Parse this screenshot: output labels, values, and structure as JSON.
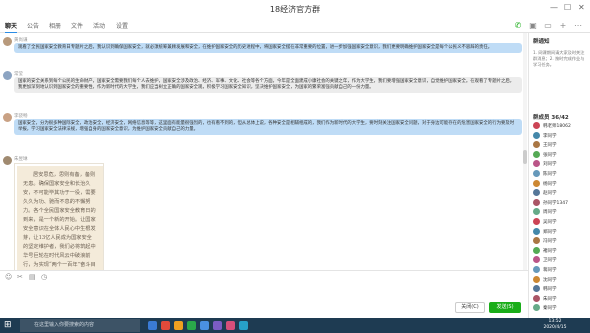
{
  "window": {
    "title": "18经济官方群"
  },
  "tabs": [
    {
      "label": "聊天"
    },
    {
      "label": "公告"
    },
    {
      "label": "相册"
    },
    {
      "label": "文件"
    },
    {
      "label": "活动"
    },
    {
      "label": "设置"
    }
  ],
  "messages": [
    {
      "sender": "黄尚谦",
      "text": "观看了全民国家安全教育日专题片之后，我认识到确保国家安全，就必须统筹兼顾发展和安全，在维护国家安全的历史进程中，将国家安全摆在非常重要的位置，进一步加强国家安全意识，我们更要明确维护国家安全是每个公民义不容辞的责任。"
    },
    {
      "sender": "常莹",
      "text": "国家的安全关系到每个公民的生命财产，国家安全需要我们每个人去维护，国家安全涉及政治、经济、军事、文化、社会等各个方面，今年是全面建成小康社会的关键之年，作为大学生，我们要增强国家安全意识，自觉维护国家安全。在观看了专题片之后，我更加深刻地认识到国家安全的重要性，作为新时代的大学生，我们应当树立正确的国家安全观，积极学习国家安全知识，坚决维护国家安全，为国家的繁荣富强贡献自己的一份力量。"
    },
    {
      "sender": "李骁畅",
      "text": "国家安全，分为很多种国际安全，政治安全，经济安全，网络信息等等，这里面有能量很强烈的，也有看不到的，但从总体上说，各种安全是相辅相成的，我们作为新时代的大学生，要时刻关注国家安全问题，对于身边可能存在的危害国家安全的行为要及时举报，学习国家安全法律法规，增强自身的国家安全意识，为维护国家安全贡献自己的力量。"
    }
  ],
  "image_message": {
    "sender": "朱昱琳",
    "paper_text": "居安思危，思则有备，备则无患。确保国家安全和长治久安，不可能毕其功于一役，需要久久为功、驰而不息的不懈努力。各个全民国家安全教育日的到来，是一个新的开始。让国家安全意识在全体人民心中生根发芽，让13亿人民成为国家安全的坚定维护者，我们必将筑起中华号巨轮在时代风云中破浪前行，为实现“两个一百年”奋斗目标，实现中华民族伟大复兴的中国梦筑牢安全屏障"
  },
  "input": {
    "close_label": "关闭(C)",
    "send_label": "发送(S)"
  },
  "right": {
    "notice_title": "群通知",
    "notice_text": "1. 网课期间请大家及时关注群消息；2. 按时完成作业与学习任务。",
    "members_title": "群成员 36/42",
    "members": [
      "韩老师18062",
      "李同学",
      "王同学",
      "张同学",
      "刘同学",
      "陈同学",
      "杨同学",
      "赵同学",
      "孙同学1347",
      "周同学",
      "吴同学",
      "郑同学",
      "冯同学",
      "褚同学",
      "卫同学",
      "蒋同学",
      "沈同学",
      "韩同学",
      "朱同学",
      "秦同学"
    ]
  },
  "taskbar": {
    "search_placeholder": "在这里输入你要搜索的内容",
    "time": "13:52",
    "date": "2020/4/15"
  }
}
